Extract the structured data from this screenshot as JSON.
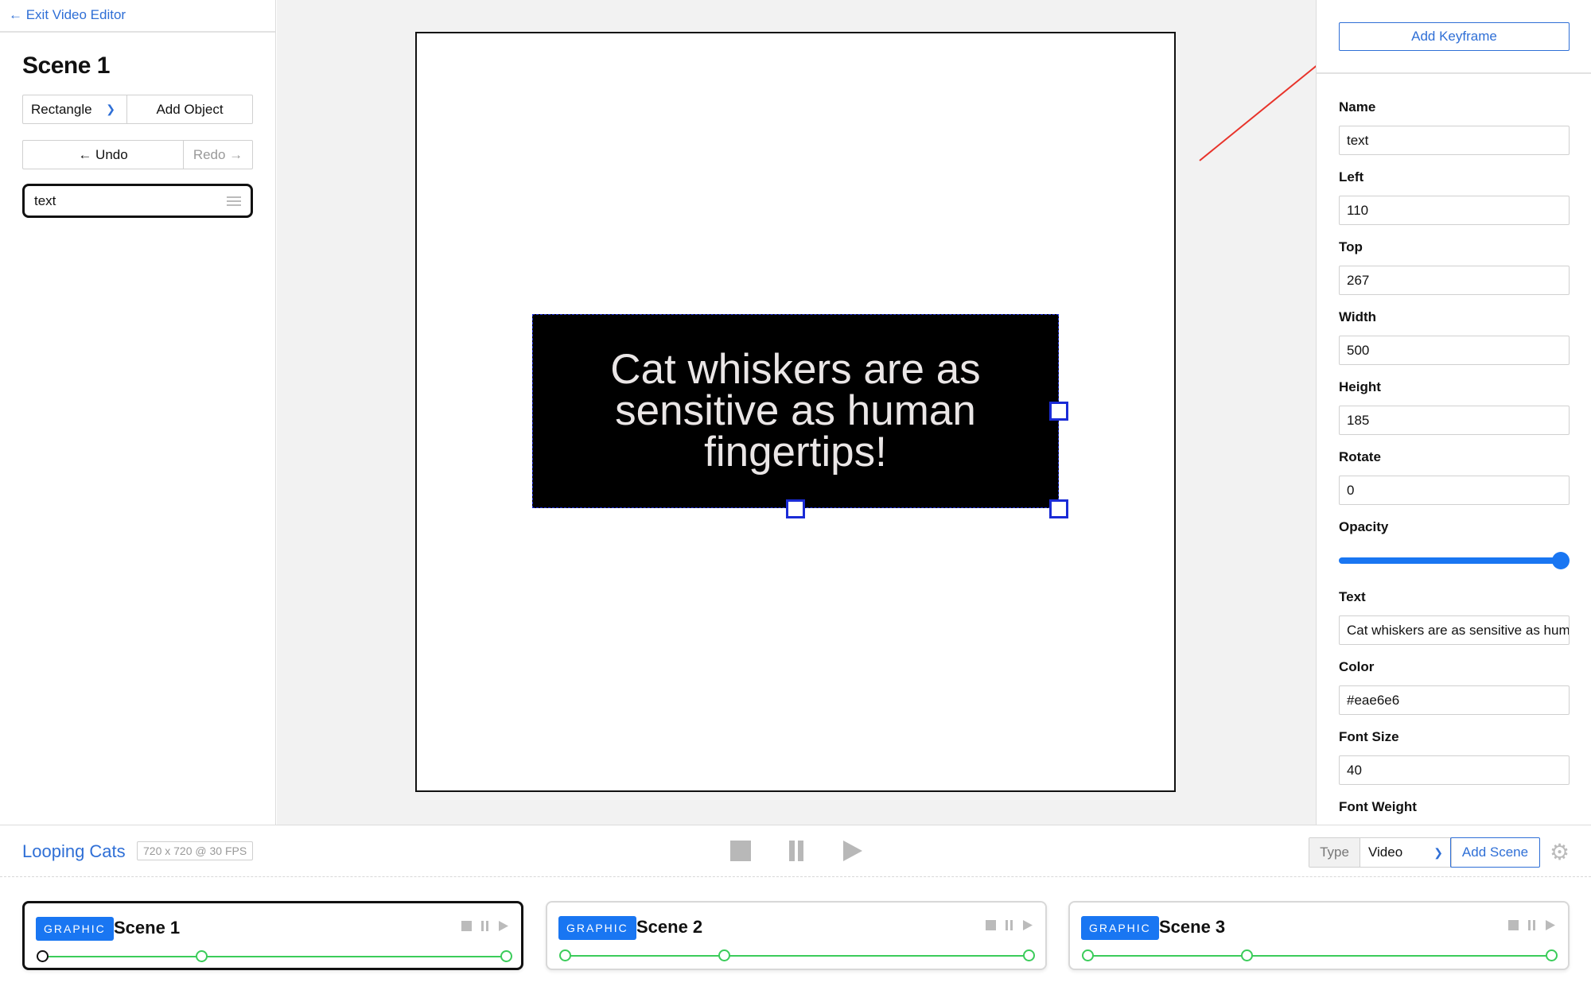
{
  "left_panel": {
    "exit_label": "← Exit Video Editor",
    "scene_title": "Scene 1",
    "shape_select": "Rectangle",
    "add_object_label": "Add Object",
    "undo_label": "← Undo",
    "redo_label": "Redo →",
    "layers": [
      {
        "name": "text"
      }
    ]
  },
  "canvas": {
    "text": "Cat whiskers are as sensitive as human fingertips!",
    "text_color": "#eae6e6",
    "box_color": "#000000",
    "selection_color": "#1a2bd6"
  },
  "right_panel": {
    "add_keyframe_label": "Add Keyframe",
    "fields": {
      "name": {
        "label": "Name",
        "value": "text"
      },
      "left": {
        "label": "Left",
        "value": "110"
      },
      "top": {
        "label": "Top",
        "value": "267"
      },
      "width": {
        "label": "Width",
        "value": "500"
      },
      "height": {
        "label": "Height",
        "value": "185"
      },
      "rotate": {
        "label": "Rotate",
        "value": "0"
      },
      "opacity": {
        "label": "Opacity",
        "value_fraction": 1.0
      },
      "text": {
        "label": "Text",
        "value": "Cat whiskers are as sensitive as human fingertips!"
      },
      "color": {
        "label": "Color",
        "value": "#eae6e6"
      },
      "font_size": {
        "label": "Font Size",
        "value": "40"
      },
      "font_weight": {
        "label": "Font Weight",
        "value": ""
      }
    }
  },
  "bottom_bar": {
    "project_name": "Looping Cats",
    "dims_label": "720 x 720 @ 30 FPS",
    "type_label": "Type",
    "type_value": "Video",
    "add_scene_label": "Add Scene",
    "icons": [
      "stop-icon",
      "pause-icon",
      "play-icon",
      "gear-icon"
    ]
  },
  "scenes": [
    {
      "badge": "GRAPHIC",
      "name": "Scene 1",
      "active": true
    },
    {
      "badge": "GRAPHIC",
      "name": "Scene 2",
      "active": false
    },
    {
      "badge": "GRAPHIC",
      "name": "Scene 3",
      "active": false
    }
  ],
  "accent_color": "#2f6fd6",
  "timeline_color": "#3bcc5a"
}
